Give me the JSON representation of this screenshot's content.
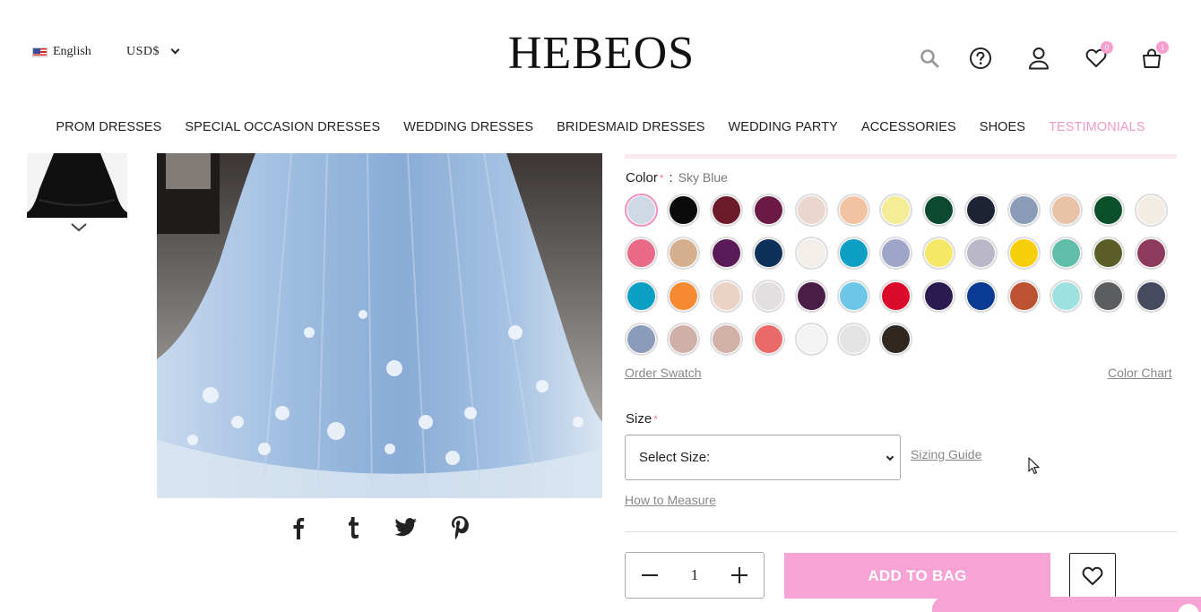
{
  "header": {
    "language": "English",
    "currency": "USD$",
    "logo": "HEBEOS",
    "wishlist_count": "0",
    "cart_count": "1"
  },
  "nav": {
    "items": [
      "PROM DRESSES",
      "SPECIAL OCCASION DRESSES",
      "WEDDING DRESSES",
      "BRIDESMAID DRESSES",
      "WEDDING PARTY",
      "ACCESSORIES",
      "SHOES",
      "TESTIMONIALS"
    ]
  },
  "product": {
    "color_label": "Color",
    "required_mark": "*",
    "color_separator": ":",
    "selected_color": "Sky Blue",
    "order_swatch": "Order Swatch",
    "color_chart": "Color Chart",
    "size_label": "Size",
    "size_select": "Select Size:",
    "sizing_guide": "Sizing Guide",
    "how_to_measure": "How to Measure",
    "quantity": "1",
    "add_to_bag": "ADD TO BAG"
  },
  "swatches": [
    "#cfd9e6",
    "#0b0b0b",
    "#6b1a2a",
    "#6a1a45",
    "#ead6cc",
    "#f2c3a1",
    "#f5ec96",
    "#0b4a30",
    "#1e2335",
    "#8b9cb8",
    "#e9c3a8",
    "#0b4f2b",
    "#f2ece2",
    "#e86a86",
    "#d5b08e",
    "#5a1a58",
    "#0d3158",
    "#f3eee8",
    "#0ea0c4",
    "#9ea5c8",
    "#f5e866",
    "#b9b7c8",
    "#f6cf0a",
    "#5fbda9",
    "#5a5e26",
    "#8d3a5d",
    "#0ea0c4",
    "#f58a33",
    "#ecd2c4",
    "#e3dfe1",
    "#4a1c48",
    "#6ec6e6",
    "#db0a2a",
    "#2a1a50",
    "#0b3a92",
    "#bd5233",
    "#9fe0e0",
    "#5b5d5e",
    "#454a5e",
    "#8b9cbb",
    "#cfb0a6",
    "#d1b0a6",
    "#ea6a6a",
    "#f3f3f3",
    "#e3e3e3",
    "#2f2720"
  ],
  "colors": {
    "accent_pink": "#f8a3d5",
    "nav_highlight": "#f19ac9",
    "selected_ring": "#f08fc0"
  },
  "icons": [
    "flag-icon",
    "chevron-down-icon",
    "search-icon",
    "help-icon",
    "user-icon",
    "heart-icon",
    "bag-icon",
    "facebook-icon",
    "tumblr-icon",
    "twitter-icon",
    "pinterest-icon",
    "minus-icon",
    "plus-icon"
  ]
}
